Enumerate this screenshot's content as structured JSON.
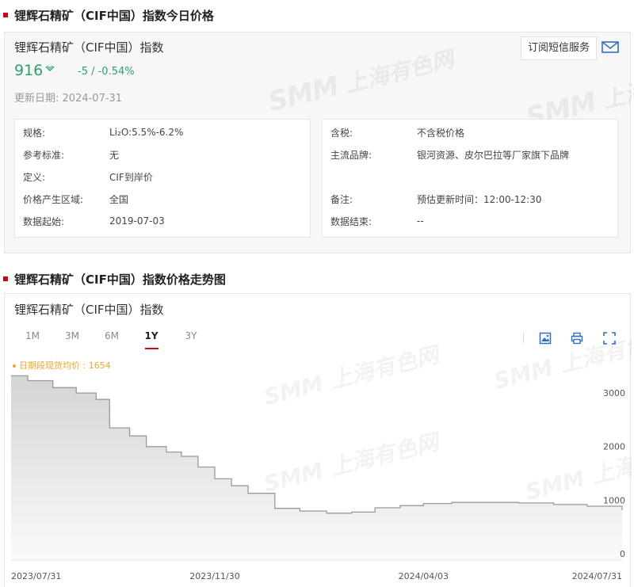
{
  "section1": {
    "title": "锂辉石精矿（CIF中国）指数今日价格"
  },
  "quote": {
    "title": "锂辉石精矿（CIF中国）指数",
    "price": "916",
    "change": "-5  /  -0.54%",
    "update_label": "更新日期:",
    "update_date": "2024-07-31",
    "subscribe_label": "订阅短信服务"
  },
  "info_left": [
    {
      "key": "规格:",
      "value": "Li₂O:5.5%-6.2%"
    },
    {
      "key": "参考标准:",
      "value": "无"
    },
    {
      "key": "定义:",
      "value": "CIF到岸价"
    },
    {
      "key": "价格产生区域:",
      "value": "全国"
    },
    {
      "key": "数据起始:",
      "value": "2019-07-03"
    }
  ],
  "info_right": [
    {
      "key": "含税:",
      "value": "不含税价格"
    },
    {
      "key": "主流品牌:",
      "value": "银河资源、皮尔巴拉等厂家旗下品牌"
    },
    {
      "key": "备注:",
      "value": "预估更新时间：12:00-12:30"
    },
    {
      "key": "数据结束:",
      "value": "--"
    }
  ],
  "section2": {
    "title": "锂辉石精矿（CIF中国）指数价格走势图"
  },
  "chart_panel": {
    "title": "锂辉石精矿（CIF中国）指数",
    "tabs": [
      "1M",
      "3M",
      "6M",
      "1Y",
      "3Y"
    ],
    "active_tab": "1Y",
    "average_label": "日期段现货均价 : 1654"
  },
  "watermark": {
    "brand": "SMM",
    "text": "上海有色网"
  },
  "colors": {
    "accent_red": "#d0021b",
    "down_green": "#2aa36b",
    "average_orange": "#f5a623",
    "line": "#999999"
  },
  "chart_data": {
    "type": "area",
    "title": "",
    "xlabel": "",
    "ylabel": "",
    "ylim": [
      0,
      3500
    ],
    "y_ticks": [
      0,
      1000,
      2000,
      3000
    ],
    "x_ticks": [
      "2023/07/31",
      "2023/11/30",
      "2024/04/03",
      "2024/07/31"
    ],
    "x_range": [
      "2023-07-31",
      "2024-07-31"
    ],
    "grid": false,
    "x": [
      "2023-07-31",
      "2023-08-10",
      "2023-08-25",
      "2023-09-08",
      "2023-09-20",
      "2023-09-28",
      "2023-10-10",
      "2023-10-20",
      "2023-11-01",
      "2023-11-10",
      "2023-11-20",
      "2023-11-30",
      "2023-12-10",
      "2023-12-20",
      "2024-01-05",
      "2024-01-20",
      "2024-02-05",
      "2024-02-20",
      "2024-03-05",
      "2024-03-20",
      "2024-04-03",
      "2024-04-20",
      "2024-05-10",
      "2024-05-30",
      "2024-06-20",
      "2024-07-10",
      "2024-07-31"
    ],
    "values": [
      3420,
      3330,
      3200,
      3100,
      2980,
      2450,
      2300,
      2100,
      2000,
      1920,
      1720,
      1500,
      1370,
      1230,
      950,
      900,
      860,
      880,
      960,
      1000,
      1040,
      1060,
      1060,
      1050,
      1020,
      990,
      916
    ]
  }
}
